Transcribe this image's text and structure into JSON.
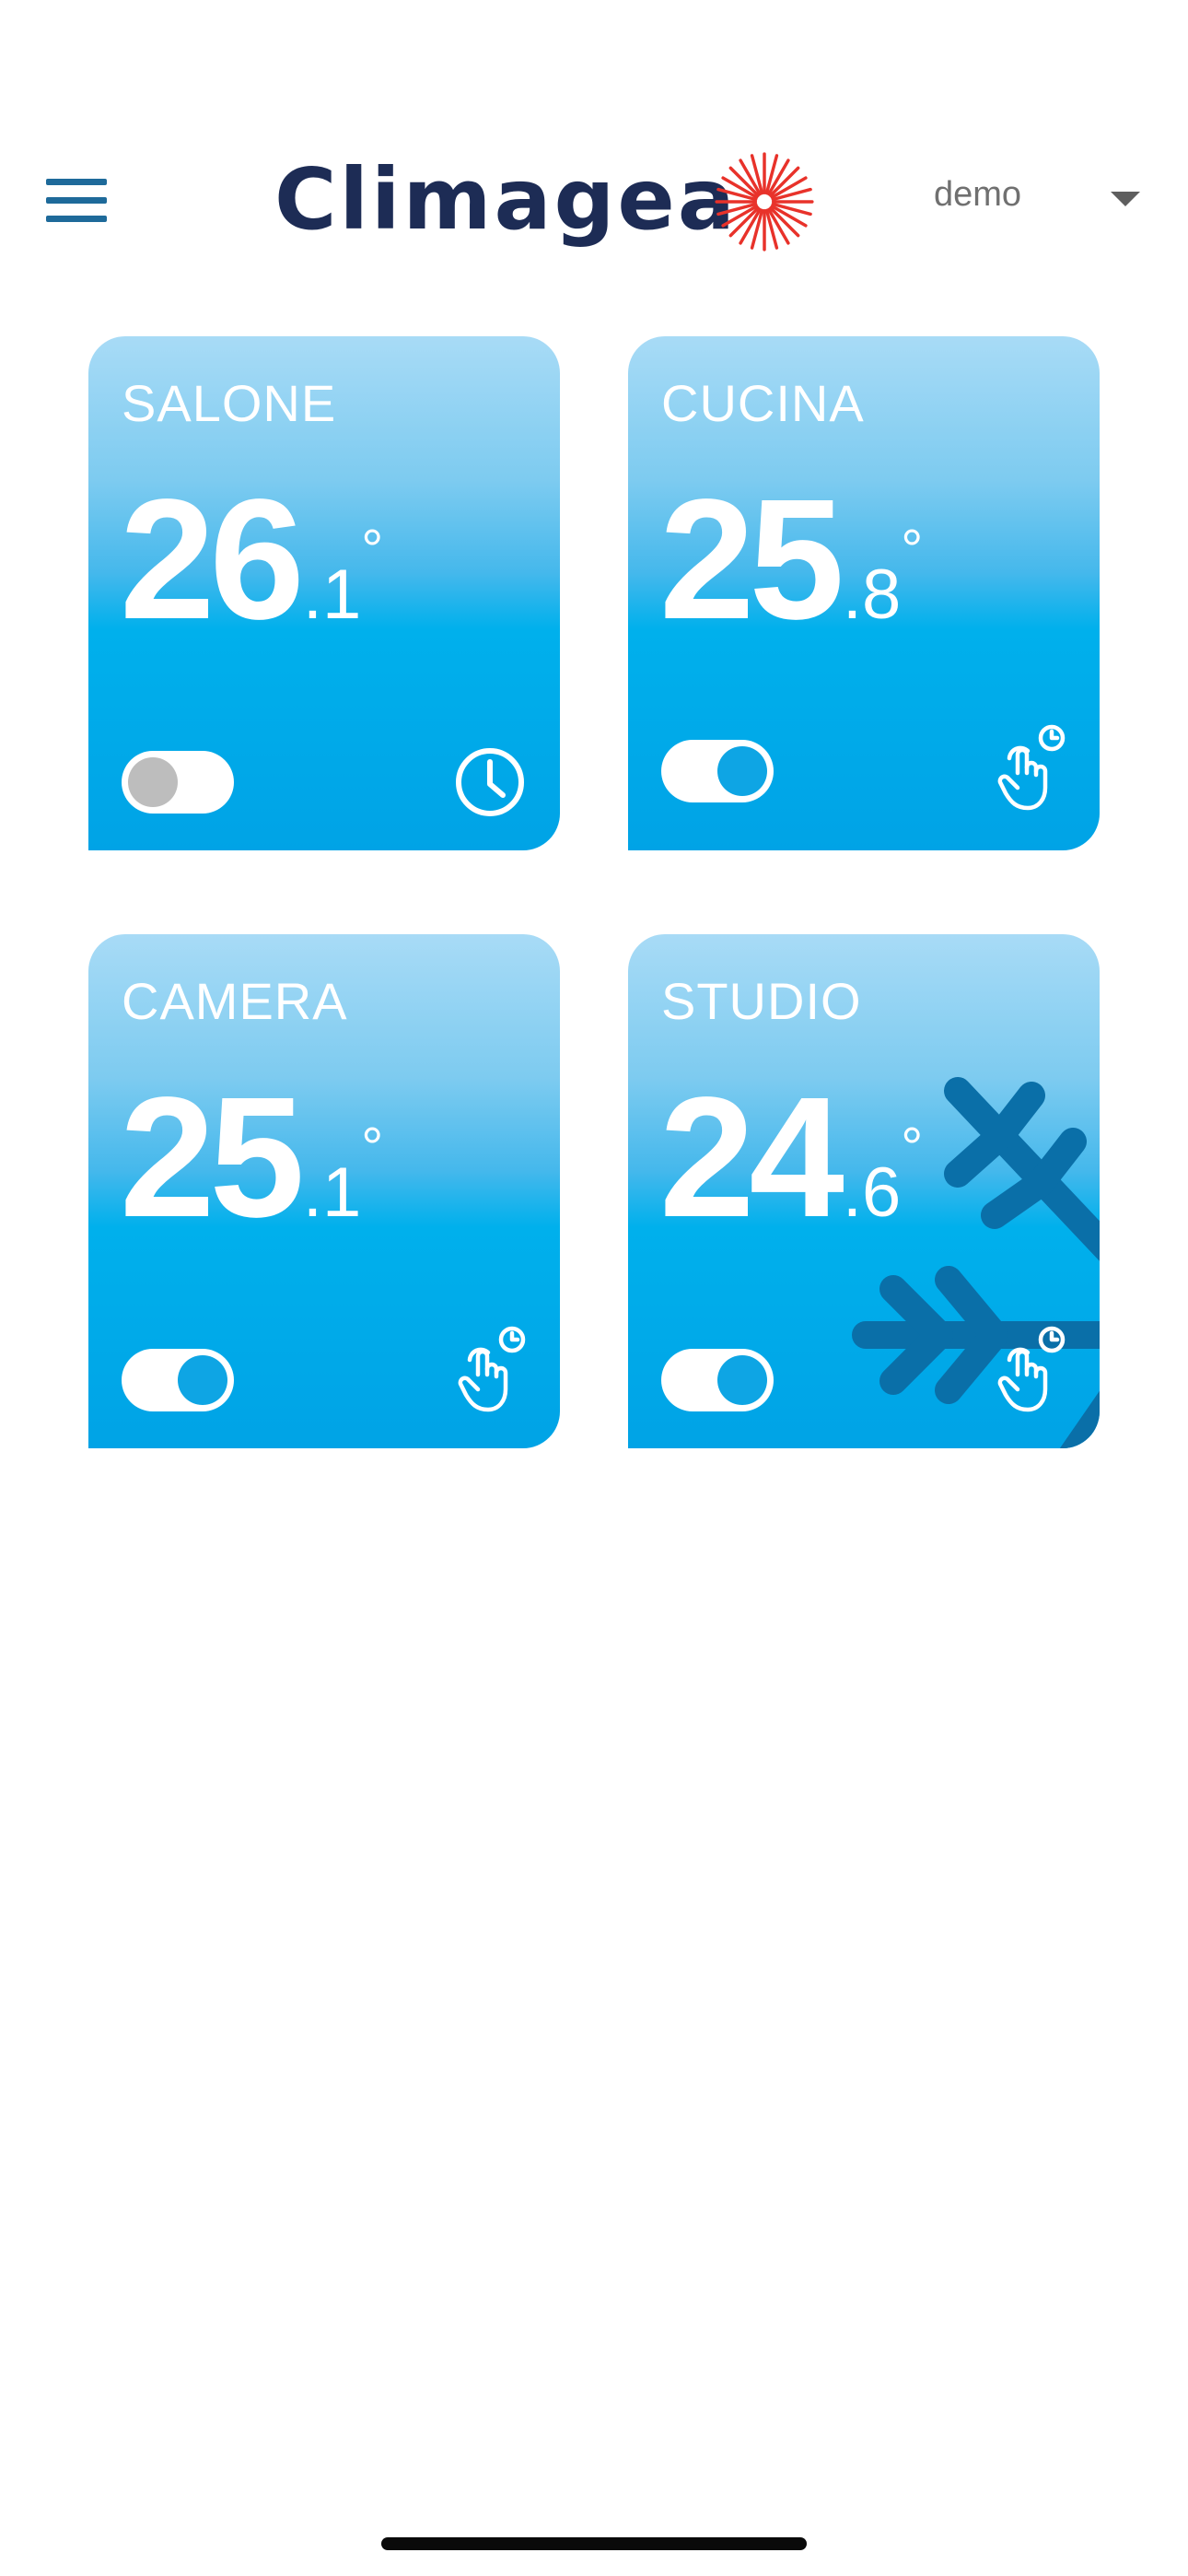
{
  "header": {
    "menu_icon": "hamburger-menu-icon",
    "logo_text": "Climagea",
    "logo_icon": "sun-burst-icon",
    "user_name": "demo",
    "user_caret_icon": "caret-down-icon"
  },
  "colors": {
    "accent": "#1e6a9a",
    "logo_text": "#1d2c55",
    "logo_sun": "#e8322a",
    "card_top": "#a8dbf6",
    "card_bottom": "#00a3e6",
    "toggle_on_knob": "#0ea5e4",
    "toggle_off_knob": "#bdbdbd",
    "snowflake": "#0a6fa8"
  },
  "rooms": [
    {
      "name": "SALONE",
      "temp_int": "26",
      "temp_dec": ".1",
      "temp_unit": "°",
      "enabled": false,
      "mode_icon": "clock-schedule-icon",
      "cooling": false
    },
    {
      "name": "CUCINA",
      "temp_int": "25",
      "temp_dec": ".8",
      "temp_unit": "°",
      "enabled": true,
      "mode_icon": "manual-hand-timer-icon",
      "cooling": false
    },
    {
      "name": "CAMERA",
      "temp_int": "25",
      "temp_dec": ".1",
      "temp_unit": "°",
      "enabled": true,
      "mode_icon": "manual-hand-timer-icon",
      "cooling": false
    },
    {
      "name": "STUDIO",
      "temp_int": "24",
      "temp_dec": ".6",
      "temp_unit": "°",
      "enabled": true,
      "mode_icon": "manual-hand-timer-icon",
      "cooling": true
    }
  ]
}
